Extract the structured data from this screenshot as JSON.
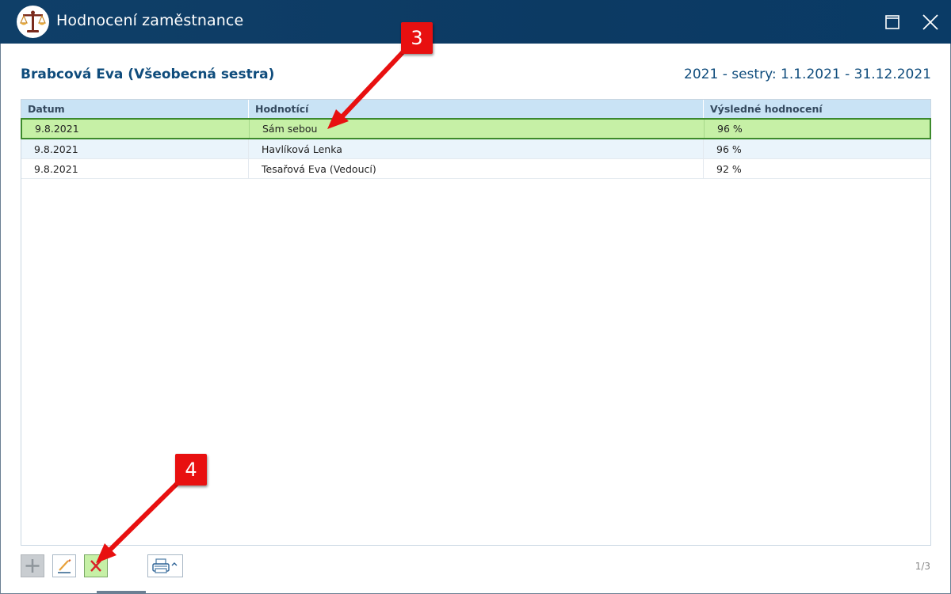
{
  "window": {
    "title": "Hodnocení zaměstnance",
    "logo_icon": "scales-of-justice-icon",
    "controls": [
      "maximize-icon",
      "close-icon"
    ]
  },
  "employee": {
    "name": "Brabcová Eva (Všeobecná sestra)",
    "period": "2021 - sestry: 1.1.2021 - 31.12.2021"
  },
  "table": {
    "columns": [
      "Datum",
      "Hodnotící",
      "Výsledné hodnocení"
    ],
    "rows": [
      {
        "date": "9.8.2021",
        "evaluator": "Sám sebou",
        "result": "96 %",
        "selected": true
      },
      {
        "date": "9.8.2021",
        "evaluator": "Havlíková Lenka",
        "result": "96 %",
        "selected": false
      },
      {
        "date": "9.8.2021",
        "evaluator": "Tesařová Eva (Vedoucí)",
        "result": "92 %",
        "selected": false
      }
    ]
  },
  "toolbar": {
    "buttons": [
      "plus-icon",
      "pencil-icon",
      "delete-x-icon",
      "printer-icon"
    ]
  },
  "pager": {
    "text": "1/3"
  },
  "annotations": [
    {
      "label": "3"
    },
    {
      "label": "4"
    }
  ],
  "colors": {
    "titlebar": "#0c3a63",
    "accent_text": "#0f4c7c",
    "header_bg": "#c9e3f5",
    "selected_row": "#c6f0a6",
    "selected_border": "#3c8a2c",
    "annotation": "#e81010"
  }
}
